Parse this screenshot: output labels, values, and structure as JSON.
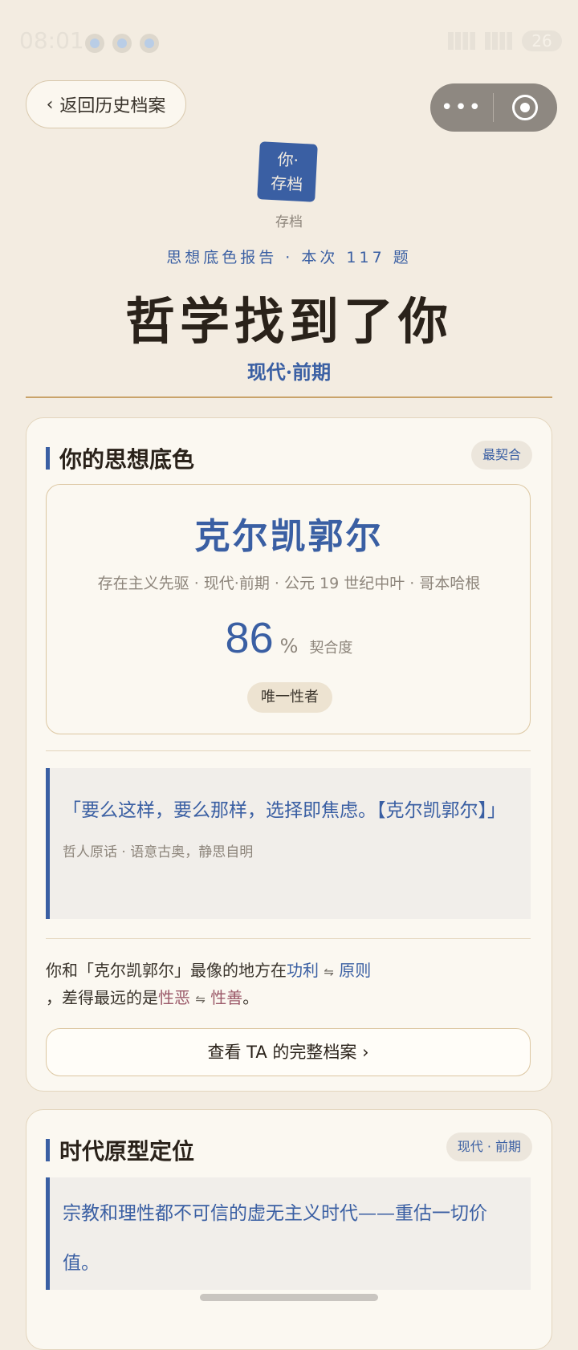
{
  "status_bar": {
    "time": "08:01",
    "battery": "26"
  },
  "nav": {
    "back_label": "返回历史档案",
    "back_chevron": "‹",
    "more_glyph": "•••"
  },
  "seal": {
    "line1": "你·",
    "line2": "存档",
    "label": "存档"
  },
  "header": {
    "report_line": "思想底色报告 · 本次 117 题",
    "title": "哲学找到了你",
    "era": "现代·前期"
  },
  "section1": {
    "title": "你的思想底色",
    "badge": "最契合",
    "philosopher": {
      "name": "克尔凯郭尔",
      "meta": "存在主义先驱 · 现代·前期 · 公元 19 世纪中叶 · 哥本哈根",
      "score": "86",
      "score_unit": "%",
      "score_label": "契合度",
      "tag": "唯一性者"
    },
    "quote": {
      "text": "「要么这样，要么那样，选择即焦虑。【克尔凯郭尔】」",
      "source": "哲人原话 · 语意古奥，静思自明"
    },
    "compare": {
      "prefix": "你和「克尔凯郭尔」最像的地方在",
      "like_a": "功利",
      "like_b": "原则",
      "mid": "，差得最远的是",
      "far_a": "性恶",
      "far_b": "性善",
      "suffix": "。",
      "arrow": "⇋"
    },
    "button": "查看 TA 的完整档案 ›"
  },
  "section2": {
    "title": "时代原型定位",
    "badge": "现代 · 前期",
    "text": "宗教和理性都不可信的虚无主义时代——重估一切价值。"
  },
  "colors": {
    "accent": "#3a5fa3",
    "background": "#f3ece1",
    "gold_rule": "#c9a36a",
    "rose": "#9c5a6a"
  }
}
